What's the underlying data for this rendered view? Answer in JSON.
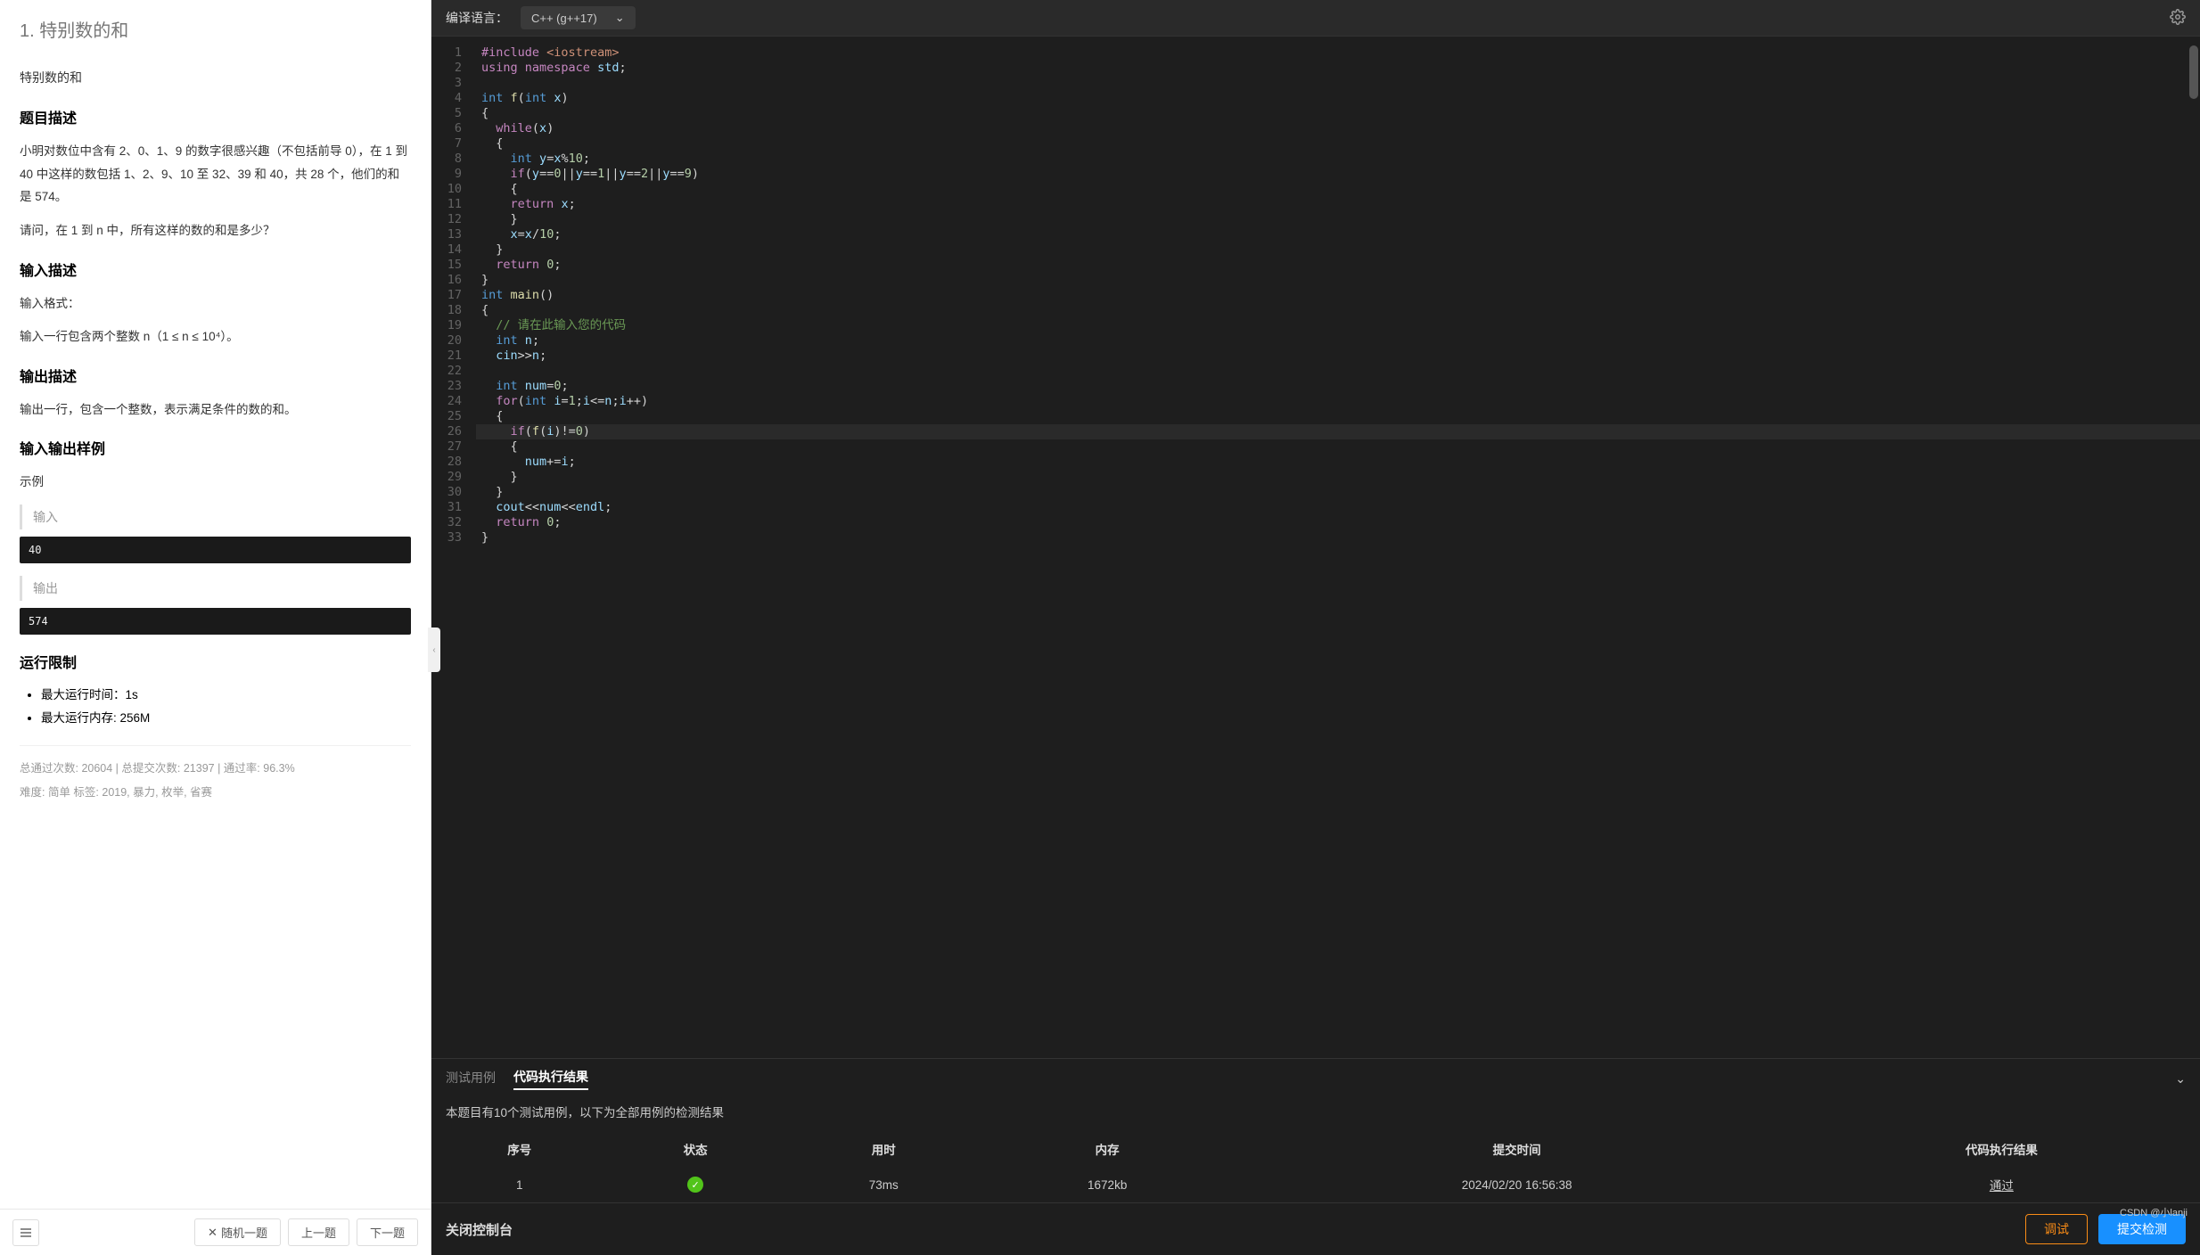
{
  "problem": {
    "number_title": "1. 特别数的和",
    "subtitle": "特别数的和",
    "sections": {
      "desc_heading": "题目描述",
      "desc_p1": "小明对数位中含有 2、0、1、9 的数字很感兴趣（不包括前导 0），在 1 到 40 中这样的数包括 1、2、9、10 至 32、39 和 40，共 28 个，他们的和是 574。",
      "desc_p2": "请问，在 1 到 n 中，所有这样的数的和是多少？",
      "input_heading": "输入描述",
      "input_p1": "输入格式：",
      "input_p2": "输入一行包含两个整数 n（1 ≤ n ≤ 10⁴）。",
      "output_heading": "输出描述",
      "output_p1": "输出一行，包含一个整数，表示满足条件的数的和。",
      "sample_heading": "输入输出样例",
      "sample_label": "示例",
      "sample_input_label": "输入",
      "sample_input": "40",
      "sample_output_label": "输出",
      "sample_output": "574",
      "limits_heading": "运行限制",
      "limit_time": "最大运行时间：1s",
      "limit_mem": "最大运行内存: 256M"
    },
    "stats": {
      "line": "总通过次数: 20604  |  总提交次数: 21397  |  通过率: 96.3%",
      "tags": "难度: 简单    标签: 2019, 暴力, 枚举, 省赛"
    },
    "nav": {
      "shuffle": "随机一题",
      "prev": "上一题",
      "next": "下一题"
    }
  },
  "editor": {
    "compile_label": "编译语言：",
    "lang": "C++ (g++17)",
    "code_lines": [
      [
        [
          "t-kw",
          "#include"
        ],
        [
          "t-pl",
          " "
        ],
        [
          "t-str",
          "<iostream>"
        ]
      ],
      [
        [
          "t-kw",
          "using"
        ],
        [
          "t-pl",
          " "
        ],
        [
          "t-kw",
          "namespace"
        ],
        [
          "t-pl",
          " "
        ],
        [
          "t-var",
          "std"
        ],
        [
          "t-op",
          ";"
        ]
      ],
      [],
      [
        [
          "t-ty",
          "int"
        ],
        [
          "t-pl",
          " "
        ],
        [
          "t-fn",
          "f"
        ],
        [
          "t-op",
          "("
        ],
        [
          "t-ty",
          "int"
        ],
        [
          "t-pl",
          " "
        ],
        [
          "t-var",
          "x"
        ],
        [
          "t-op",
          ")"
        ]
      ],
      [
        [
          "t-op",
          "{"
        ]
      ],
      [
        [
          "t-pl",
          "  "
        ],
        [
          "t-kw",
          "while"
        ],
        [
          "t-op",
          "("
        ],
        [
          "t-var",
          "x"
        ],
        [
          "t-op",
          ")"
        ]
      ],
      [
        [
          "t-pl",
          "  "
        ],
        [
          "t-op",
          "{"
        ]
      ],
      [
        [
          "t-pl",
          "    "
        ],
        [
          "t-ty",
          "int"
        ],
        [
          "t-pl",
          " "
        ],
        [
          "t-var",
          "y"
        ],
        [
          "t-op",
          "="
        ],
        [
          "t-var",
          "x"
        ],
        [
          "t-op",
          "%"
        ],
        [
          "t-num",
          "10"
        ],
        [
          "t-op",
          ";"
        ]
      ],
      [
        [
          "t-pl",
          "    "
        ],
        [
          "t-kw",
          "if"
        ],
        [
          "t-op",
          "("
        ],
        [
          "t-var",
          "y"
        ],
        [
          "t-op",
          "=="
        ],
        [
          "t-num",
          "0"
        ],
        [
          "t-op",
          "||"
        ],
        [
          "t-var",
          "y"
        ],
        [
          "t-op",
          "=="
        ],
        [
          "t-num",
          "1"
        ],
        [
          "t-op",
          "||"
        ],
        [
          "t-var",
          "y"
        ],
        [
          "t-op",
          "=="
        ],
        [
          "t-num",
          "2"
        ],
        [
          "t-op",
          "||"
        ],
        [
          "t-var",
          "y"
        ],
        [
          "t-op",
          "=="
        ],
        [
          "t-num",
          "9"
        ],
        [
          "t-op",
          ")"
        ]
      ],
      [
        [
          "t-pl",
          "    "
        ],
        [
          "t-op",
          "{"
        ]
      ],
      [
        [
          "t-pl",
          "    "
        ],
        [
          "t-kw",
          "return"
        ],
        [
          "t-pl",
          " "
        ],
        [
          "t-var",
          "x"
        ],
        [
          "t-op",
          ";"
        ]
      ],
      [
        [
          "t-pl",
          "    "
        ],
        [
          "t-op",
          "}"
        ]
      ],
      [
        [
          "t-pl",
          "    "
        ],
        [
          "t-var",
          "x"
        ],
        [
          "t-op",
          "="
        ],
        [
          "t-var",
          "x"
        ],
        [
          "t-op",
          "/"
        ],
        [
          "t-num",
          "10"
        ],
        [
          "t-op",
          ";"
        ]
      ],
      [
        [
          "t-pl",
          "  "
        ],
        [
          "t-op",
          "}"
        ]
      ],
      [
        [
          "t-pl",
          "  "
        ],
        [
          "t-kw",
          "return"
        ],
        [
          "t-pl",
          " "
        ],
        [
          "t-num",
          "0"
        ],
        [
          "t-op",
          ";"
        ]
      ],
      [
        [
          "t-op",
          "}"
        ]
      ],
      [
        [
          "t-ty",
          "int"
        ],
        [
          "t-pl",
          " "
        ],
        [
          "t-fn",
          "main"
        ],
        [
          "t-op",
          "()"
        ]
      ],
      [
        [
          "t-op",
          "{"
        ]
      ],
      [
        [
          "t-pl",
          "  "
        ],
        [
          "t-cm",
          "// 请在此输入您的代码"
        ]
      ],
      [
        [
          "t-pl",
          "  "
        ],
        [
          "t-ty",
          "int"
        ],
        [
          "t-pl",
          " "
        ],
        [
          "t-var",
          "n"
        ],
        [
          "t-op",
          ";"
        ]
      ],
      [
        [
          "t-pl",
          "  "
        ],
        [
          "t-var",
          "cin"
        ],
        [
          "t-op",
          ">>"
        ],
        [
          "t-var",
          "n"
        ],
        [
          "t-op",
          ";"
        ]
      ],
      [],
      [
        [
          "t-pl",
          "  "
        ],
        [
          "t-ty",
          "int"
        ],
        [
          "t-pl",
          " "
        ],
        [
          "t-var",
          "num"
        ],
        [
          "t-op",
          "="
        ],
        [
          "t-num",
          "0"
        ],
        [
          "t-op",
          ";"
        ]
      ],
      [
        [
          "t-pl",
          "  "
        ],
        [
          "t-kw",
          "for"
        ],
        [
          "t-op",
          "("
        ],
        [
          "t-ty",
          "int"
        ],
        [
          "t-pl",
          " "
        ],
        [
          "t-var",
          "i"
        ],
        [
          "t-op",
          "="
        ],
        [
          "t-num",
          "1"
        ],
        [
          "t-op",
          ";"
        ],
        [
          "t-var",
          "i"
        ],
        [
          "t-op",
          "<="
        ],
        [
          "t-var",
          "n"
        ],
        [
          "t-op",
          ";"
        ],
        [
          "t-var",
          "i"
        ],
        [
          "t-op",
          "++)"
        ]
      ],
      [
        [
          "t-pl",
          "  "
        ],
        [
          "t-op",
          "{"
        ]
      ],
      [
        [
          "t-pl",
          "    "
        ],
        [
          "t-kw",
          "if"
        ],
        [
          "t-op",
          "("
        ],
        [
          "t-fn",
          "f"
        ],
        [
          "t-op",
          "("
        ],
        [
          "t-var",
          "i"
        ],
        [
          "t-op",
          ")!="
        ],
        [
          "t-num",
          "0"
        ],
        [
          "t-op",
          ")"
        ]
      ],
      [
        [
          "t-pl",
          "    "
        ],
        [
          "t-op",
          "{"
        ]
      ],
      [
        [
          "t-pl",
          "      "
        ],
        [
          "t-var",
          "num"
        ],
        [
          "t-op",
          "+="
        ],
        [
          "t-var",
          "i"
        ],
        [
          "t-op",
          ";"
        ]
      ],
      [
        [
          "t-pl",
          "    "
        ],
        [
          "t-op",
          "}"
        ]
      ],
      [
        [
          "t-pl",
          "  "
        ],
        [
          "t-op",
          "}"
        ]
      ],
      [
        [
          "t-pl",
          "  "
        ],
        [
          "t-var",
          "cout"
        ],
        [
          "t-op",
          "<<"
        ],
        [
          "t-var",
          "num"
        ],
        [
          "t-op",
          "<<"
        ],
        [
          "t-var",
          "endl"
        ],
        [
          "t-op",
          ";"
        ]
      ],
      [
        [
          "t-pl",
          "  "
        ],
        [
          "t-kw",
          "return"
        ],
        [
          "t-pl",
          " "
        ],
        [
          "t-num",
          "0"
        ],
        [
          "t-op",
          ";"
        ]
      ],
      [
        [
          "t-op",
          "}"
        ]
      ]
    ],
    "current_line": 26
  },
  "results": {
    "tabs": {
      "cases": "测试用例",
      "output": "代码执行结果"
    },
    "info": "本题目有10个测试用例，以下为全部用例的检测结果",
    "headers": [
      "序号",
      "状态",
      "用时",
      "内存",
      "提交时间",
      "代码执行结果"
    ],
    "row": {
      "idx": "1",
      "time": "73ms",
      "mem": "1672kb",
      "submit": "2024/02/20 16:56:38",
      "result": "通过"
    }
  },
  "footer": {
    "close": "关闭控制台",
    "debug": "调试",
    "submit": "提交检测"
  },
  "watermark": "CSDN @小lanji"
}
